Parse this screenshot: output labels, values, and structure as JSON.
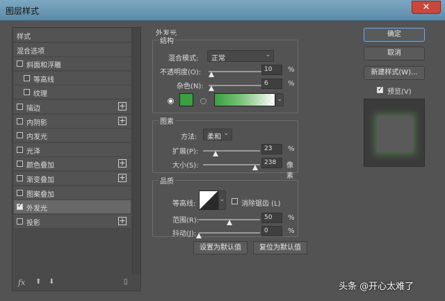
{
  "window": {
    "title": "图层样式",
    "close_glyph": "✕"
  },
  "left_panel": {
    "items": [
      {
        "label": "样式",
        "checkbox": false,
        "checked": false,
        "plus": false,
        "selected": false
      },
      {
        "label": "混合选项",
        "checkbox": false,
        "checked": false,
        "plus": false,
        "selected": false
      },
      {
        "label": "斜面和浮雕",
        "checkbox": true,
        "checked": false,
        "plus": false,
        "selected": false
      },
      {
        "label": "等高线",
        "checkbox": true,
        "checked": false,
        "plus": false,
        "selected": false,
        "indent": true
      },
      {
        "label": "纹理",
        "checkbox": true,
        "checked": false,
        "plus": false,
        "selected": false,
        "indent": true
      },
      {
        "label": "描边",
        "checkbox": true,
        "checked": false,
        "plus": true,
        "selected": false
      },
      {
        "label": "内阴影",
        "checkbox": true,
        "checked": false,
        "plus": true,
        "selected": false
      },
      {
        "label": "内发光",
        "checkbox": true,
        "checked": false,
        "plus": false,
        "selected": false
      },
      {
        "label": "光泽",
        "checkbox": true,
        "checked": false,
        "plus": false,
        "selected": false
      },
      {
        "label": "颜色叠加",
        "checkbox": true,
        "checked": false,
        "plus": true,
        "selected": false
      },
      {
        "label": "渐变叠加",
        "checkbox": true,
        "checked": false,
        "plus": true,
        "selected": false
      },
      {
        "label": "图案叠加",
        "checkbox": true,
        "checked": false,
        "plus": false,
        "selected": false
      },
      {
        "label": "外发光",
        "checkbox": true,
        "checked": true,
        "plus": false,
        "selected": true
      },
      {
        "label": "投影",
        "checkbox": true,
        "checked": false,
        "plus": true,
        "selected": false
      }
    ],
    "bottom": {
      "fx": "fx",
      "up": "⬆",
      "down": "⬇",
      "trash": "🗑"
    }
  },
  "outer_glow": {
    "title": "外发光",
    "structure": {
      "title": "结构",
      "blend_mode_label": "混合模式:",
      "blend_mode_value": "正常",
      "opacity_label": "不透明度(O):",
      "opacity_value": "10",
      "opacity_unit": "%",
      "noise_label": "杂色(N):",
      "noise_value": "6",
      "noise_unit": "%",
      "glow_color": "#3aa040"
    },
    "elements": {
      "title": "图素",
      "technique_label": "方法:",
      "technique_value": "柔和",
      "spread_label": "扩展(P):",
      "spread_value": "23",
      "spread_unit": "%",
      "size_label": "大小(S):",
      "size_value": "238",
      "size_unit": "像素"
    },
    "quality": {
      "title": "品质",
      "contour_label": "等高线:",
      "antialias_label": "消除锯齿 (L)",
      "range_label": "范围(R):",
      "range_value": "50",
      "range_unit": "%",
      "jitter_label": "抖动(J):",
      "jitter_value": "0",
      "jitter_unit": "%"
    },
    "make_default": "设置为默认值",
    "reset_default": "复位为默认值"
  },
  "right_panel": {
    "ok": "确定",
    "cancel": "取消",
    "new_style": "新建样式(W)...",
    "preview_label": "预览(V)"
  },
  "watermark": "头条 @开心太难了"
}
